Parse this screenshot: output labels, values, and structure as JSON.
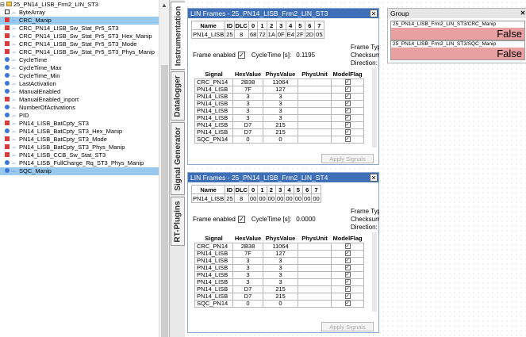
{
  "tree": {
    "root": "25_PN14_LISB_Frm2_LIN_ST3",
    "items": [
      {
        "label": "ByteArray",
        "icon": "bytearray-icon"
      },
      {
        "label": "CRC_Manip",
        "icon": "signal-icon",
        "selected": true
      },
      {
        "label": "CRC_PN14_LISB_Sw_Stat_Pr5_ST3",
        "icon": "signal-icon"
      },
      {
        "label": "CRC_PN14_LISB_Sw_Stat_Pr5_ST3_Hex_Manip",
        "icon": "signal-icon"
      },
      {
        "label": "CRC_PN14_LISB_Sw_Stat_Pr5_ST3_Mode",
        "icon": "signal-icon"
      },
      {
        "label": "CRC_PN14_LISB_Sw_Stat_Pr5_ST3_Phys_Manip",
        "icon": "signal-icon"
      },
      {
        "label": "CycleTime",
        "icon": "property-icon"
      },
      {
        "label": "CycleTime_Max",
        "icon": "property-icon"
      },
      {
        "label": "CycleTime_Min",
        "icon": "property-icon"
      },
      {
        "label": "LastActivation",
        "icon": "property-icon"
      },
      {
        "label": "ManualEnabled",
        "icon": "property-icon"
      },
      {
        "label": "ManualEnabled_inport",
        "icon": "signal-icon"
      },
      {
        "label": "NumberOfActivations",
        "icon": "property-icon"
      },
      {
        "label": "PID",
        "icon": "property-icon"
      },
      {
        "label": "PN14_LISB_BatCpty_ST3",
        "icon": "signal-icon"
      },
      {
        "label": "PN14_LISB_BatCpty_ST3_Hex_Manip",
        "icon": "property-icon"
      },
      {
        "label": "PN14_LISB_BatCpty_ST3_Mode",
        "icon": "signal-icon"
      },
      {
        "label": "PN14_LISB_BatCpty_ST3_Phys_Manip",
        "icon": "signal-icon"
      },
      {
        "label": "PN14_LISB_CCB_Sw_Stat_ST3",
        "icon": "signal-icon"
      },
      {
        "label": "PN14_LISB_FullCharge_Rq_ST3_Phys_Manip",
        "icon": "property-icon"
      },
      {
        "label": "SQC_Manip",
        "icon": "property-icon",
        "selected": true
      }
    ]
  },
  "tabs": [
    "Instrumentation",
    "Datalogger",
    "Signal Generator",
    "RT-Plugins"
  ],
  "win1": {
    "title": "LIN Frames - 25_PN14_LISB_Frm2_LIN_ST3",
    "header": [
      "Name",
      "ID",
      "DLC",
      "0",
      "1",
      "2",
      "3",
      "4",
      "5",
      "6",
      "7"
    ],
    "values": [
      "PN14_LISB",
      "25",
      "8",
      "68",
      "72",
      "1A",
      "0F",
      "E4",
      "2F",
      "2D",
      "05"
    ],
    "frame_enabled_label": "Frame enabled",
    "cycletime_label": "CycleTime [s]:",
    "cycletime_value": "0.1195",
    "frame_type_label": "Frame Typ",
    "checksum_label": "Checksum",
    "direction_label": "Direction:"
  },
  "win2": {
    "title": "LIN Frames - 25_PN14_LISB_Frm2_LIN_ST4",
    "header": [
      "Name",
      "ID",
      "DLC",
      "0",
      "1",
      "2",
      "3",
      "4",
      "5",
      "6",
      "7"
    ],
    "values": [
      "PN14_LISB",
      "25",
      "8",
      "00",
      "00",
      "00",
      "00",
      "00",
      "00",
      "00",
      "00"
    ],
    "frame_enabled_label": "Frame enabled",
    "cycletime_label": "CycleTime [s]:",
    "cycletime_value": "0.0000",
    "frame_type_label": "Frame Typ",
    "checksum_label": "Checksum",
    "direction_label": "Direction:"
  },
  "signals": {
    "columns": [
      "Signal",
      "HexValue",
      "PhysValue",
      "PhysUnit",
      "ModelFlag"
    ],
    "rows": [
      [
        "CRC_PN14",
        "2B38",
        "11064",
        ""
      ],
      [
        "PN14_LISB",
        "7F",
        "127",
        ""
      ],
      [
        "PN14_LISB",
        "3",
        "3",
        ""
      ],
      [
        "PN14_LISB",
        "3",
        "3",
        ""
      ],
      [
        "PN14_LISB",
        "3",
        "3",
        ""
      ],
      [
        "PN14_LISB",
        "3",
        "3",
        ""
      ],
      [
        "PN14_LISB",
        "D7",
        "215",
        ""
      ],
      [
        "PN14_LISB",
        "D7",
        "215",
        ""
      ],
      [
        "SQC_PN14",
        "0",
        "0",
        ""
      ]
    ]
  },
  "apply_label": "Apply Signals",
  "group": {
    "title": "Group",
    "items": [
      {
        "label": "25_PN14_LISB_Frm2_LIN_ST3/CRC_Manip",
        "value": "False"
      },
      {
        "label": "25_PN14_LISB_Frm2_LIN_ST3/SQC_Manip",
        "value": "False"
      }
    ]
  },
  "colors": {
    "title_bar": "#3f6fb7",
    "selection": "#99c9ef",
    "false_bg": "#e8a0a0"
  }
}
